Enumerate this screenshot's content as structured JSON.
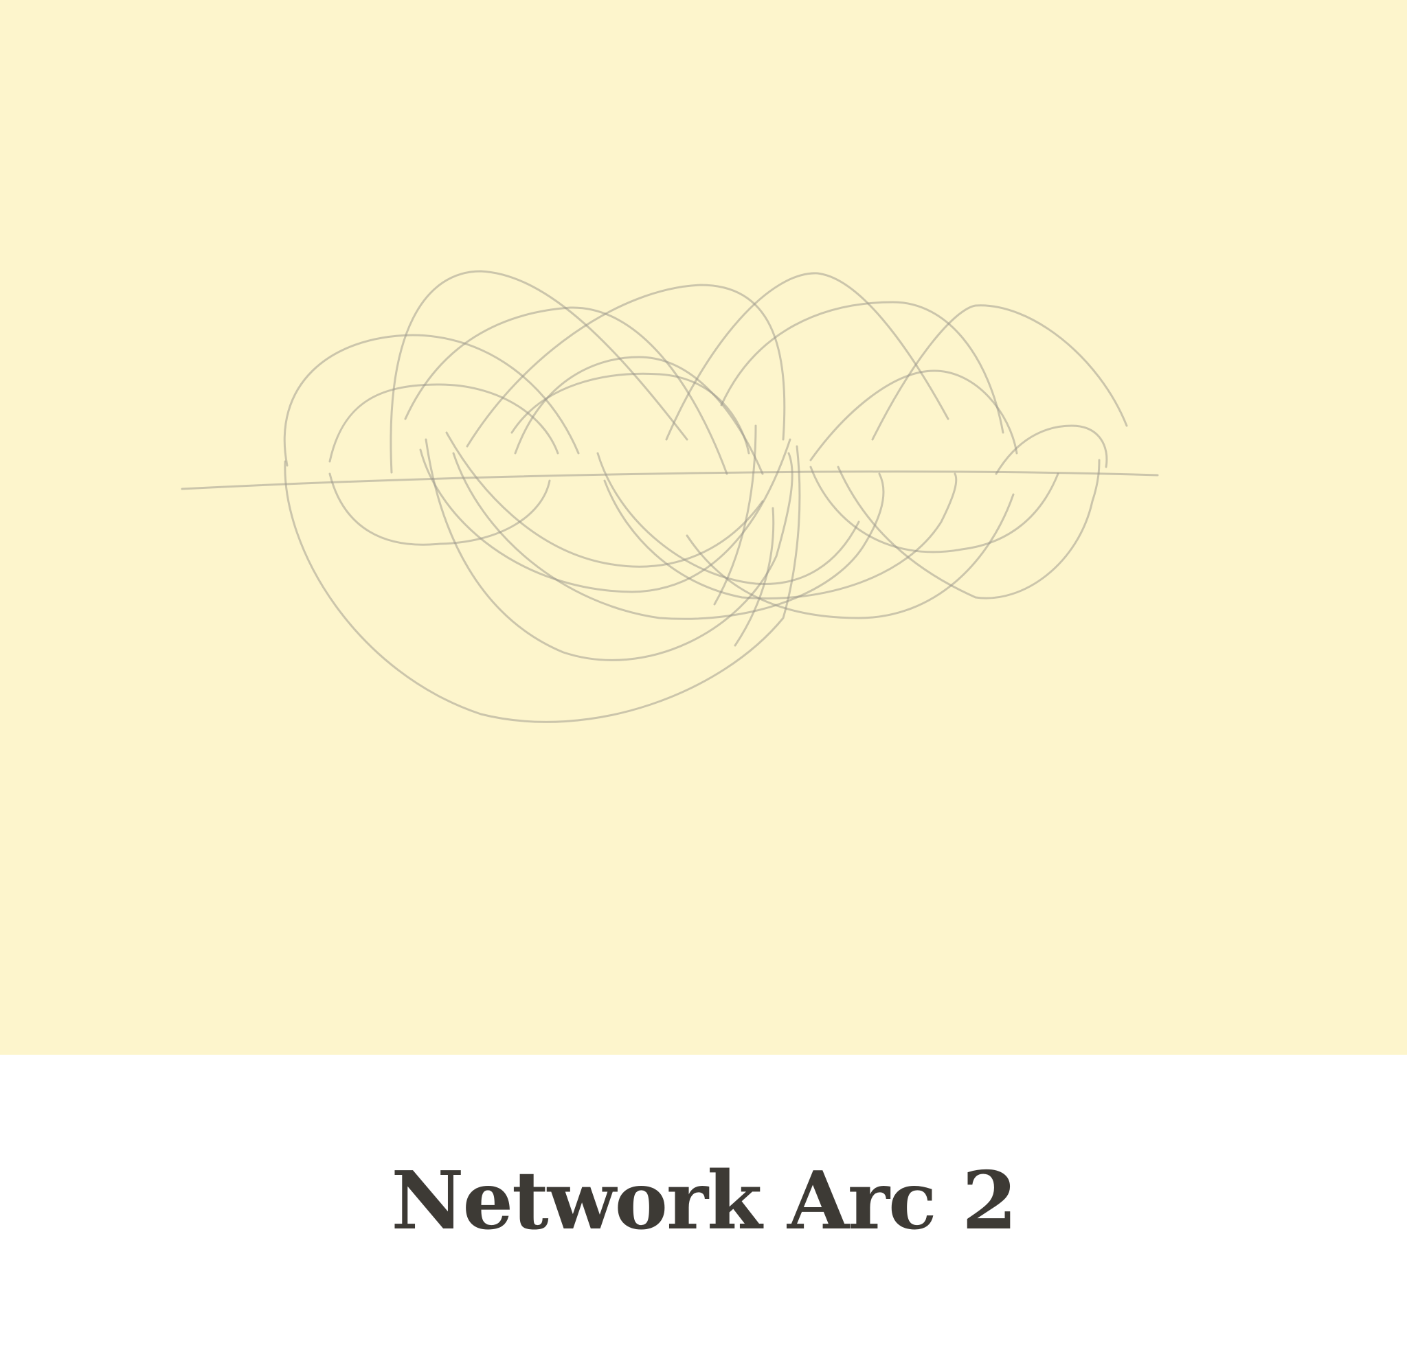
{
  "caption": {
    "title": "Network Arc 2"
  },
  "colors": {
    "panel_background": "#fdf5cc",
    "page_background": "#ffffff",
    "caption_text": "#3d3a35",
    "pencil_stroke": "#9a968a"
  }
}
